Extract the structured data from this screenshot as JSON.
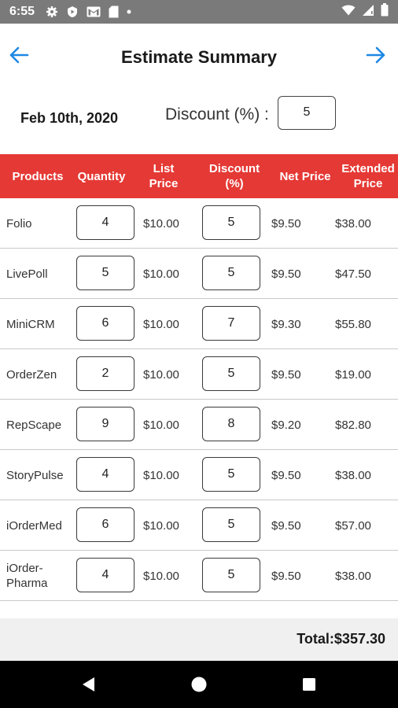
{
  "status_bar": {
    "time": "6:55",
    "icons": [
      "gear-icon",
      "shield-icon",
      "gmail-icon",
      "sd-card-icon",
      "dot-icon",
      "wifi-icon",
      "signal-icon",
      "battery-icon"
    ]
  },
  "app_bar": {
    "title": "Estimate Summary",
    "back_icon": "arrow-left-icon",
    "forward_icon": "arrow-right-icon",
    "accent_color": "#1e88e5"
  },
  "summary": {
    "date": "Feb 10th, 2020",
    "discount_label": "Discount (%) :",
    "discount_value": "5"
  },
  "table": {
    "header_color": "#e53935",
    "columns": {
      "products": "Products",
      "quantity": "Quantity",
      "list_price_1": "List",
      "list_price_2": "Price",
      "discount_1": "Discount",
      "discount_2": "(%)",
      "net_price": "Net Price",
      "extended_1": "Extended",
      "extended_2": "Price"
    },
    "rows": [
      {
        "product": "Folio",
        "qty": "4",
        "list": "$10.00",
        "disc": "5",
        "net": "$9.50",
        "ext": "$38.00"
      },
      {
        "product": "LivePoll",
        "qty": "5",
        "list": "$10.00",
        "disc": "5",
        "net": "$9.50",
        "ext": "$47.50"
      },
      {
        "product": "MiniCRM",
        "qty": "6",
        "list": "$10.00",
        "disc": "7",
        "net": "$9.30",
        "ext": "$55.80"
      },
      {
        "product": "OrderZen",
        "qty": "2",
        "list": "$10.00",
        "disc": "5",
        "net": "$9.50",
        "ext": "$19.00"
      },
      {
        "product": "RepScape",
        "qty": "9",
        "list": "$10.00",
        "disc": "8",
        "net": "$9.20",
        "ext": "$82.80"
      },
      {
        "product": "StoryPulse",
        "qty": "4",
        "list": "$10.00",
        "disc": "5",
        "net": "$9.50",
        "ext": "$38.00"
      },
      {
        "product": "iOrderMed",
        "qty": "6",
        "list": "$10.00",
        "disc": "5",
        "net": "$9.50",
        "ext": "$57.00"
      },
      {
        "product": "iOrder-\nPharma",
        "qty": "4",
        "list": "$10.00",
        "disc": "5",
        "net": "$9.50",
        "ext": "$38.00"
      }
    ]
  },
  "footer": {
    "total": "Total:$357.30"
  },
  "system_nav": {
    "back": "back-triangle-icon",
    "home": "home-circle-icon",
    "recents": "recents-square-icon"
  }
}
